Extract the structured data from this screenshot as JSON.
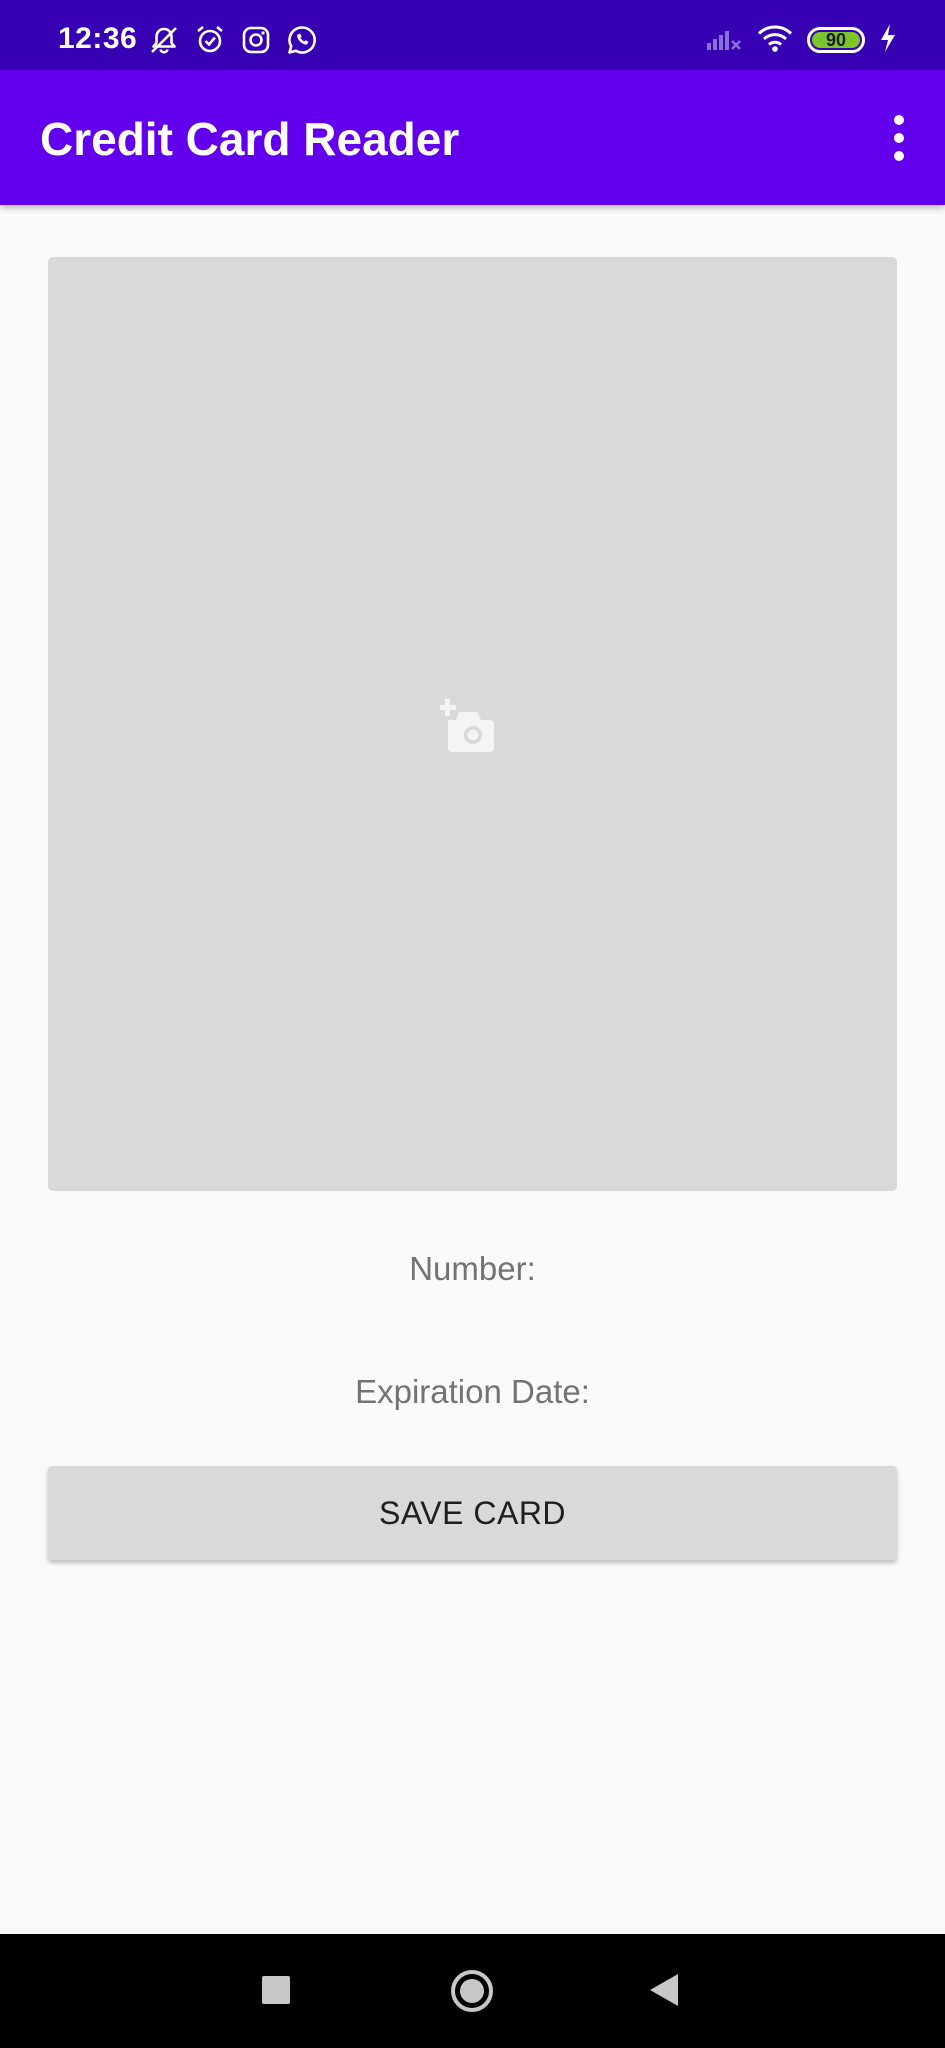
{
  "status_bar": {
    "time": "12:36",
    "left_icons": [
      "bell-off-icon",
      "alarm-icon",
      "instagram-icon",
      "whatsapp-icon"
    ],
    "right_icons": [
      "signal-off-icon",
      "wifi-icon",
      "battery-icon",
      "charging-icon"
    ],
    "battery_level": "90",
    "background": "#3700b3"
  },
  "app_bar": {
    "title": "Credit Card Reader",
    "overflow_icon": "more-vertical-icon",
    "background": "#6200ee"
  },
  "card_image": {
    "icon": "add-a-photo-icon",
    "background": "#d8d9d9"
  },
  "fields": {
    "number_label": "Number:",
    "expiration_label": "Expiration Date:"
  },
  "actions": {
    "save_label": "SAVE CARD"
  },
  "nav_bar": {
    "icons": [
      "recent-apps-icon",
      "home-icon",
      "back-icon"
    ]
  }
}
